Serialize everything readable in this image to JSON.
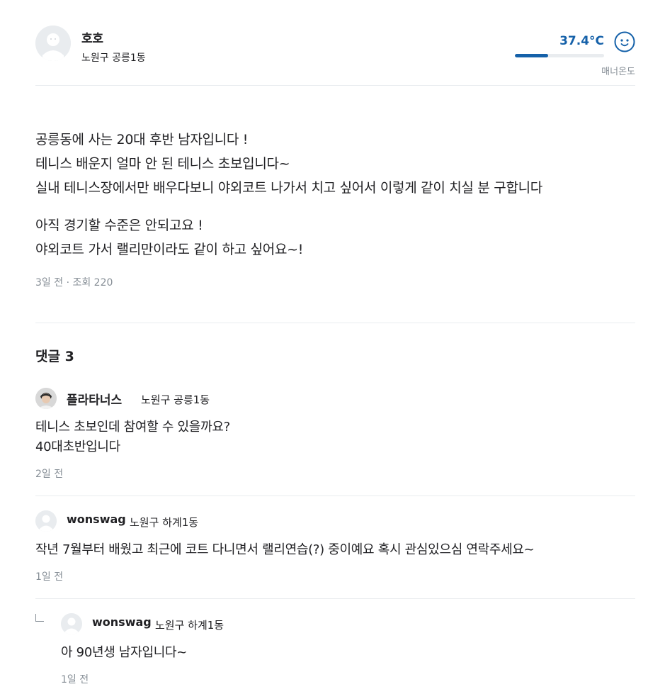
{
  "profile": {
    "nickname": "호호",
    "region": "노원구 공릉1동",
    "manner_temp": "37.4°C",
    "manner_temp_fill_fraction": 0.37,
    "manner_label": "매너온도",
    "avatar_icon": "default-avatar-icon",
    "face_icon": "smile-face-icon",
    "accent_color": "#1561a9"
  },
  "article": {
    "paragraph1": [
      "공릉동에 사는 20대 후반 남자입니다 !",
      "테니스 배운지 얼마 안 된 테니스 초보입니다~",
      "실내 테니스장에서만 배우다보니 야외코트 나가서 치고 싶어서 이렇게 같이 치실 분 구합니다"
    ],
    "paragraph2": [
      "아직 경기할 수준은 안되고요 !",
      "야외코트 가서 랠리만이라도 같이 하고 싶어요~!"
    ],
    "meta": "3일 전 · 조회 220"
  },
  "comments": {
    "title": "댓글 3",
    "items": [
      {
        "nickname": "플라타너스",
        "region": "노원구 공릉1동",
        "lines": [
          "테니스 초보인데 참여할 수 있을까요?",
          "40대초반입니다"
        ],
        "time": "2일 전"
      },
      {
        "nickname": "wonswag",
        "region": "노원구 하계1동",
        "lines": [
          "작년 7월부터 배웠고 최근에 코트 다니면서 랠리연습(?) 중이예요 혹시 관심있으심 연락주세요~"
        ],
        "time": "1일 전"
      },
      {
        "nickname": "wonswag",
        "region": "노원구 하계1동",
        "lines": [
          "아 90년생 남자입니다~"
        ],
        "time": "1일 전"
      }
    ]
  }
}
